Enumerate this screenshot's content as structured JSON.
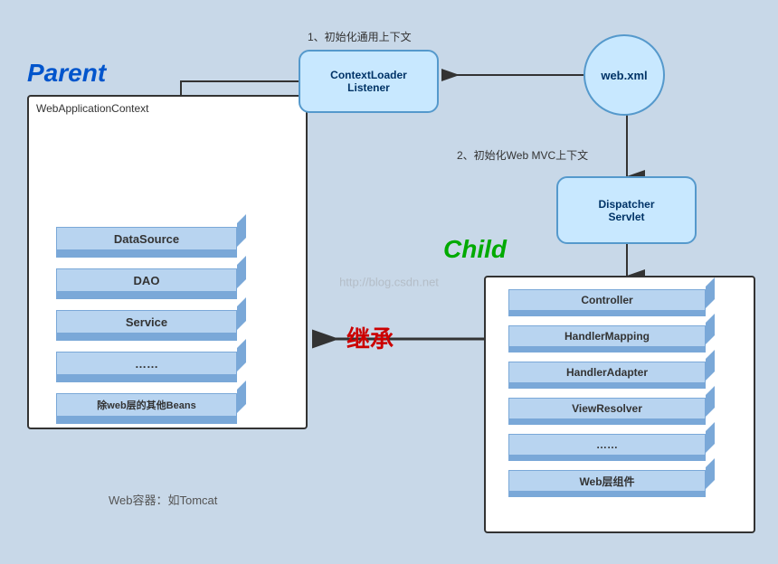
{
  "parent": {
    "label": "Parent",
    "context_label": "WebApplicationContext",
    "blocks": [
      {
        "id": "datasource",
        "text": "DataSource"
      },
      {
        "id": "dao",
        "text": "DAO"
      },
      {
        "id": "service",
        "text": "Service"
      },
      {
        "id": "dots",
        "text": "……"
      },
      {
        "id": "other-beans",
        "text": "除web层的其他Beans"
      }
    ]
  },
  "child": {
    "label": "Child",
    "blocks": [
      {
        "id": "controller",
        "text": "Controller"
      },
      {
        "id": "handler-mapping",
        "text": "HandlerMapping"
      },
      {
        "id": "handler-adapter",
        "text": "HandlerAdapter"
      },
      {
        "id": "view-resolver",
        "text": "ViewResolver"
      },
      {
        "id": "dots2",
        "text": "……"
      },
      {
        "id": "web-components",
        "text": "Web层组件"
      }
    ]
  },
  "ctx_loader": {
    "label": "ContextLoader\nListener"
  },
  "web_xml": {
    "label": "web.xml"
  },
  "dispatcher": {
    "label": "Dispatcher\nServlet"
  },
  "annotations": {
    "anno1": "1、初始化通用上下文",
    "anno2": "2、初始化Web MVC上下文"
  },
  "inheritance_text": "继承",
  "web_container_text": "Web容器：如Tomcat",
  "watermark": "http://blog.csdn.net"
}
